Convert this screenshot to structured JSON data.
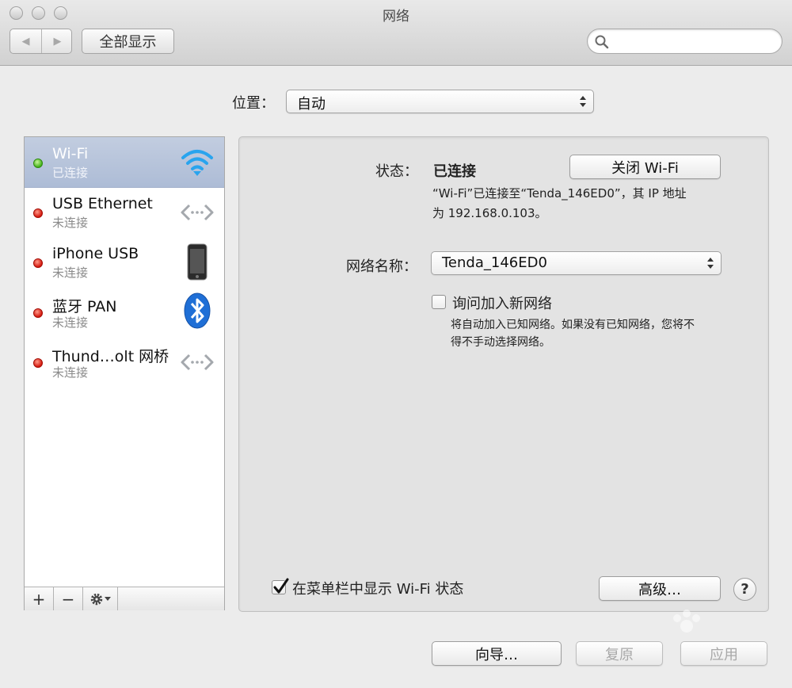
{
  "window": {
    "title": "网络"
  },
  "toolbar": {
    "back_glyph": "◀",
    "forward_glyph": "▶",
    "show_all_label": "全部显示",
    "search_placeholder": "",
    "search_icon": "search-icon"
  },
  "location": {
    "label": "位置：",
    "value": "自动"
  },
  "sidebar": {
    "items": [
      {
        "name": "Wi-Fi",
        "status": "已连接",
        "indicator": "green",
        "icon": "wifi-icon"
      },
      {
        "name": "USB Ethernet",
        "status": "未连接",
        "indicator": "red",
        "icon": "ethernet-icon"
      },
      {
        "name": "iPhone USB",
        "status": "未连接",
        "indicator": "red",
        "icon": "iphone-icon"
      },
      {
        "name": "蓝牙 PAN",
        "status": "未连接",
        "indicator": "red",
        "icon": "bluetooth-icon"
      },
      {
        "name": "Thund…olt 网桥",
        "status": "未连接",
        "indicator": "red",
        "icon": "ethernet-icon"
      }
    ],
    "add_label": "+",
    "remove_label": "−",
    "action_icon": "gear-icon"
  },
  "detail": {
    "status_label": "状态：",
    "status_value": "已连接",
    "wifi_toggle_label": "关闭 Wi-Fi",
    "status_desc_line1": "“Wi-Fi”已连接至“Tenda_146ED0”，其 IP 地址",
    "status_desc_line2": "为 192.168.0.103。",
    "network_name_label": "网络名称：",
    "network_name_value": "Tenda_146ED0",
    "ask_join_label": "询问加入新网络",
    "ask_join_checked": false,
    "ask_join_desc_line1": "将自动加入已知网络。如果没有已知网络，您将不",
    "ask_join_desc_line2": "得不手动选择网络。",
    "show_menubar_label": "在菜单栏中显示 Wi-Fi 状态",
    "show_menubar_checked": true,
    "advanced_label": "高级…",
    "help_label": "?"
  },
  "footer": {
    "assist_label": "向导…",
    "revert_label": "复原",
    "apply_label": "应用"
  },
  "colors": {
    "selected_row": "#b4c2da",
    "connected": "#42b218",
    "disconnected": "#d4170d",
    "bluetooth": "#1f6fd6"
  }
}
